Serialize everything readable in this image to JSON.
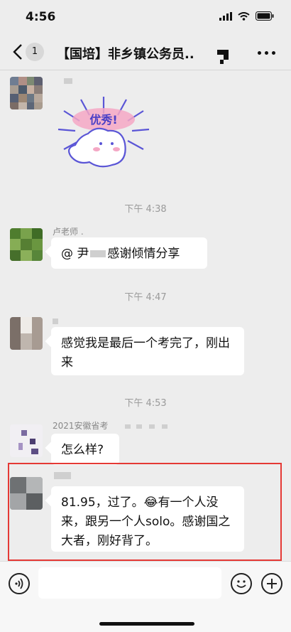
{
  "status_bar": {
    "time": "4:56"
  },
  "nav": {
    "badge": "1",
    "title": "【国培】非乡镇公务员.."
  },
  "messages": [
    {
      "kind": "sticker",
      "sticker_text": "优秀!"
    },
    {
      "kind": "time",
      "text": "下午 4:38"
    },
    {
      "kind": "text",
      "sender": "卢老师 .",
      "mention": "@ 尹",
      "text": "感谢倾情分享"
    },
    {
      "kind": "time",
      "text": "下午 4:47"
    },
    {
      "kind": "text",
      "text": "感觉我是最后一个考完了，刚出来"
    },
    {
      "kind": "time",
      "text": "下午 4:53"
    },
    {
      "kind": "text",
      "sender": "2021安徽省考",
      "text": "怎么样?"
    },
    {
      "kind": "text",
      "text": "81.95，过了。😂有一个人没来，跟另一个人solo。感谢国之大者，刚好背了。"
    }
  ],
  "colors": {
    "background": "#ededed",
    "bubble": "#ffffff",
    "highlight_border": "#e53935"
  }
}
